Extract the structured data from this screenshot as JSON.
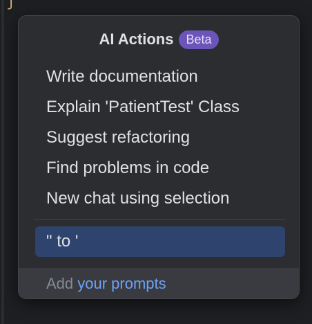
{
  "editor": {
    "gutter_glyph": "ʃ"
  },
  "popup": {
    "title": "AI Actions",
    "badge": "Beta",
    "actions": [
      {
        "label": "Write documentation"
      },
      {
        "label": "Explain 'PatientTest' Class"
      },
      {
        "label": "Suggest refactoring"
      },
      {
        "label": "Find problems in code"
      },
      {
        "label": "New chat using selection"
      }
    ],
    "custom_prompt": {
      "label": "\" to '"
    },
    "footer": {
      "prefix": "Add ",
      "link": "your prompts"
    }
  },
  "colors": {
    "popup_bg": "#2b2d30",
    "badge_bg": "#6c55b8",
    "selected_bg": "#2e436e",
    "link": "#6ea2f7"
  }
}
